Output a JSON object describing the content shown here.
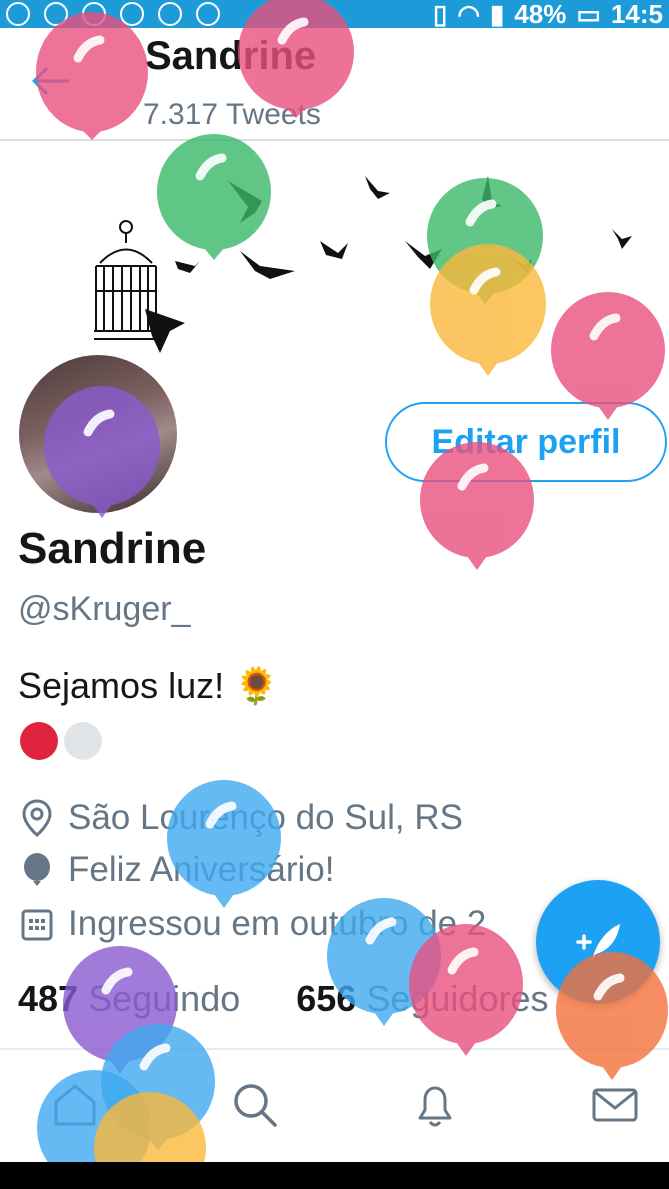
{
  "status_bar": {
    "battery": "48%",
    "time": "14:5",
    "icons": [
      "play-icon",
      "facebook-icon",
      "person-add-icon",
      "facebook-icon",
      "nav-icon",
      "whatsapp-icon",
      "vibrate-icon",
      "wifi-icon",
      "signal-icon",
      "battery-icon"
    ]
  },
  "header": {
    "title": "Sandrine",
    "subtitle": "7.317 Tweets"
  },
  "profile": {
    "edit_button": "Editar perfil",
    "name": "Sandrine",
    "handle": "@sKruger_",
    "bio": "Sejamos luz! 🌻",
    "location": "São Lourenço do Sul, RS",
    "birthday": "Feliz Aniversário!",
    "joined": "Ingressou em outubro de 2",
    "following_count": "487",
    "following_label": "Seguindo",
    "followers_count": "656",
    "followers_label": "Seguidores"
  },
  "colors": {
    "accent": "#1da1f2",
    "statusbar": "#1d9bd8",
    "muted": "#657786",
    "dot_red": "#e0243f",
    "dot_gray": "#e1e5e8"
  }
}
